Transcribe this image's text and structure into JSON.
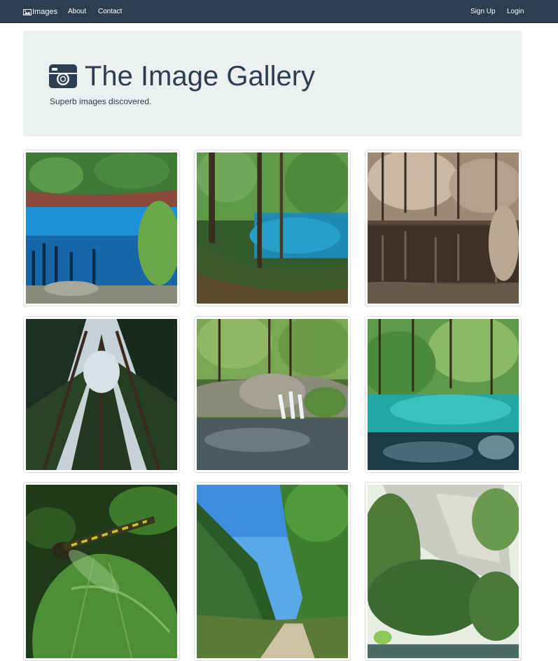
{
  "navbar": {
    "brand": "Images",
    "links": {
      "about": "About",
      "contact": "Contact",
      "signup": "Sign Up",
      "login": "Login"
    },
    "background": "#2c3e50"
  },
  "jumbotron": {
    "title": "The Image Gallery",
    "subtitle": "Superb images discovered.",
    "background": "#ecf0f1",
    "icon": "camera-icon"
  },
  "gallery": {
    "images": [
      {
        "scene": "blue forest lake"
      },
      {
        "scene": "forest lake with trees"
      },
      {
        "scene": "sepia forest lake"
      },
      {
        "scene": "tall pine trees looking up"
      },
      {
        "scene": "forest waterfall"
      },
      {
        "scene": "turquoise lake in forest"
      },
      {
        "scene": "dragonfly on leaf"
      },
      {
        "scene": "gorge with path"
      },
      {
        "scene": "cliff with river"
      }
    ]
  }
}
